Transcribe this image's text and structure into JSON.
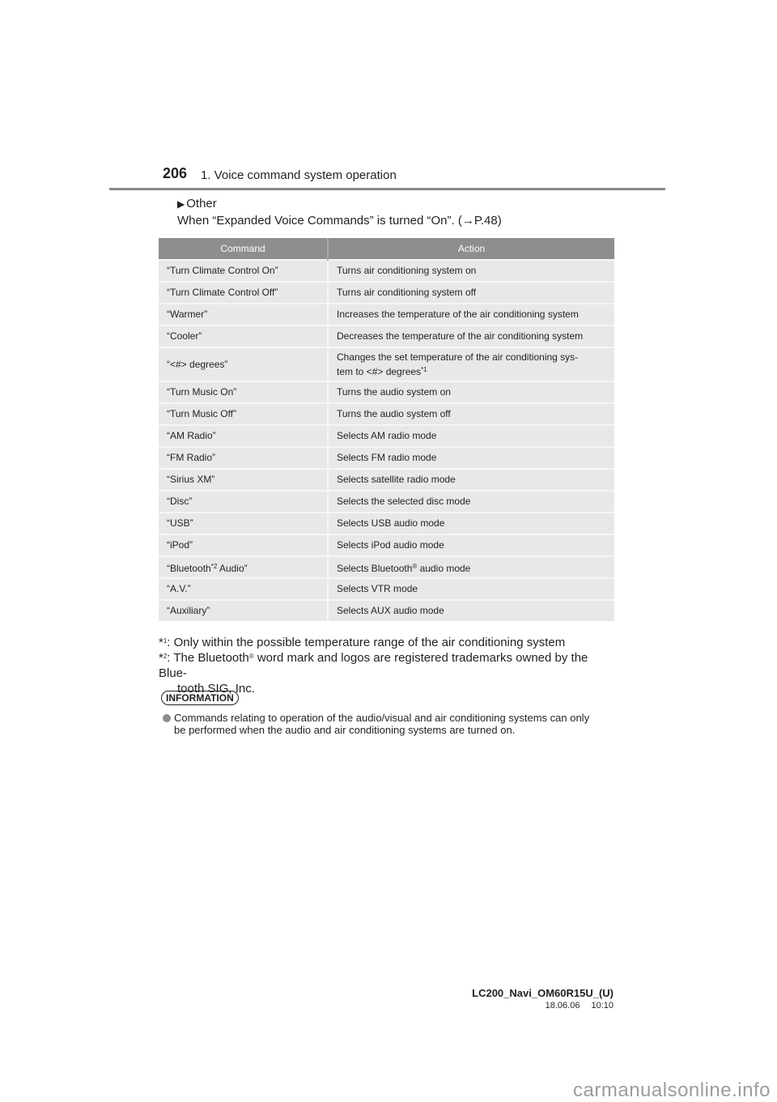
{
  "header": {
    "page_number": "206",
    "section_title": "1. Voice command system operation"
  },
  "subheading": {
    "marker_icon": "right-triangle-icon",
    "label": "Other"
  },
  "intro": {
    "text": "When “Expanded Voice Commands” is turned “On”. (→P.48)"
  },
  "table": {
    "columns": [
      "Command",
      "Action"
    ],
    "rows": [
      {
        "command": "“Turn Climate Control On”",
        "action": "Turns air conditioning system on"
      },
      {
        "command": "“Turn Climate Control Off”",
        "action": "Turns air conditioning system off"
      },
      {
        "command": "“Warmer”",
        "action": "Increases the temperature of the air conditioning system"
      },
      {
        "command": "“Cooler”",
        "action": "Decreases the temperature of the air conditioning system"
      },
      {
        "command": "“<#> degrees”",
        "action_line1": "Changes the set temperature of the air conditioning sys-",
        "action_line2": "tem to <#> degrees",
        "action_footnote": "*1"
      },
      {
        "command": "“Turn Music On”",
        "action": "Turns the audio system on"
      },
      {
        "command": "“Turn Music Off”",
        "action": "Turns the audio system off"
      },
      {
        "command": "“AM Radio”",
        "action": "Selects AM radio mode"
      },
      {
        "command": "“FM Radio”",
        "action": "Selects FM radio mode"
      },
      {
        "command": "“Sirius XM”",
        "action": "Selects satellite radio mode"
      },
      {
        "command": "“Disc”",
        "action": "Selects the selected disc mode"
      },
      {
        "command": "“USB”",
        "action": "Selects USB audio mode"
      },
      {
        "command": "“iPod”",
        "action": "Selects iPod audio mode"
      },
      {
        "command_pre": "“Bluetooth",
        "command_footnote": "*2",
        "command_post": " Audio”",
        "action_pre": "Selects Bluetooth",
        "action_mark": "®",
        "action_post": " audio mode"
      },
      {
        "command": "“A.V.”",
        "action": "Selects VTR mode"
      },
      {
        "command": "“Auxiliary”",
        "action": "Selects AUX audio mode"
      }
    ]
  },
  "footnotes": [
    {
      "mark": "*",
      "num": "1",
      "text": ": Only within the possible temperature range of the air conditioning system"
    },
    {
      "mark": "*",
      "num": "2",
      "text_pre": ": The Bluetooth",
      "reg": "®",
      "text_post": " word mark and logos are registered trademarks owned by the Blue-",
      "text_cont": "tooth SIG, Inc."
    }
  ],
  "information": {
    "badge": "INFORMATION",
    "bullet_icon": "gray-circle-bullet-icon",
    "line1": "Commands relating to operation of the audio/visual and air conditioning systems can only",
    "line2": "be performed when the audio and air conditioning systems are turned on."
  },
  "footer": {
    "doc_id": "LC200_Navi_OM60R15U_(U)",
    "date": "18.06.06",
    "time": "10:10"
  },
  "watermark": "carmanualsonline.info"
}
